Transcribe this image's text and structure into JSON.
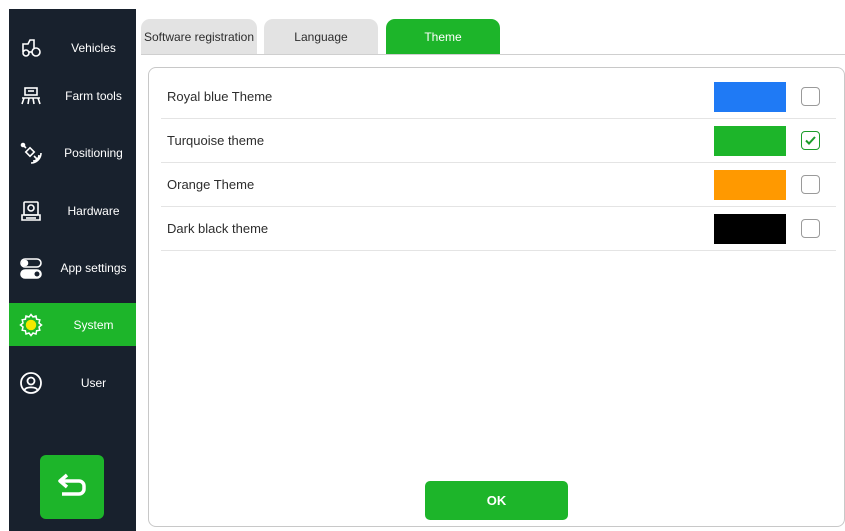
{
  "sidebar": {
    "items": [
      {
        "label": "Vehicles",
        "icon": "tractor-icon"
      },
      {
        "label": "Farm tools",
        "icon": "farm-tool-icon"
      },
      {
        "label": "Positioning",
        "icon": "satellite-icon"
      },
      {
        "label": "Hardware",
        "icon": "hardware-icon"
      },
      {
        "label": "App settings",
        "icon": "toggle-icon"
      },
      {
        "label": "System",
        "icon": "gear-icon",
        "active": true
      },
      {
        "label": "User",
        "icon": "user-icon"
      }
    ],
    "back_icon": "back-arrow-icon"
  },
  "tabs": [
    {
      "label": "Software registration"
    },
    {
      "label": "Language"
    },
    {
      "label": "Theme",
      "active": true
    }
  ],
  "themes": [
    {
      "name": "Royal blue Theme",
      "color": "#1f7af5",
      "checked": false
    },
    {
      "name": "Turquoise theme",
      "color": "#1db52a",
      "checked": true
    },
    {
      "name": "Orange Theme",
      "color": "#ff9900",
      "checked": false
    },
    {
      "name": "Dark black theme",
      "color": "#000000",
      "checked": false
    }
  ],
  "ok_label": "OK",
  "colors": {
    "accent": "#1db52a",
    "sidebar": "#18212d"
  }
}
